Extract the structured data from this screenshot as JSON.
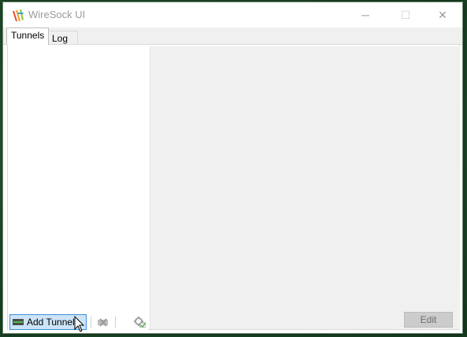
{
  "window": {
    "title": "WireSock UI",
    "app_icon": "wiresock-logo-icon",
    "controls": {
      "minimize": "─",
      "maximize": "☐",
      "close": "✕"
    }
  },
  "tabs": [
    {
      "label": "Tunnels",
      "active": true
    },
    {
      "label": "Log",
      "active": false
    }
  ],
  "toolbar": {
    "add_tunnel_label": "Add Tunnel",
    "add_tunnel_icon": "add-tunnel-icon",
    "delete_icon": "delete-tunnel-icon",
    "config_icon": "settings-gear-icon"
  },
  "details": {
    "edit_label": "Edit"
  },
  "colors": {
    "accent_hover": "#cce4f7",
    "accent_border": "#3f8fd6",
    "panel_bg": "#f0f0f0",
    "title_text": "#9a9a9a"
  }
}
